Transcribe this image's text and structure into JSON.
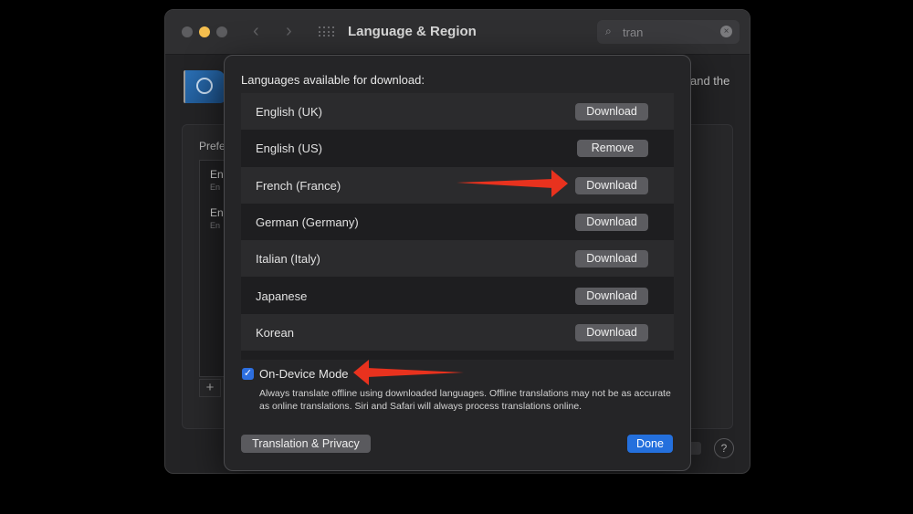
{
  "window": {
    "title": "Language & Region",
    "search_value": "tran",
    "background_right_text": "and the",
    "preferred_label": "Prefe",
    "preferred_items": [
      {
        "name": "En",
        "sub": "En"
      },
      {
        "name": "En",
        "sub": "En"
      }
    ],
    "add_symbol": "+",
    "help_symbol": "?"
  },
  "sheet": {
    "heading": "Languages available for download:",
    "languages": [
      {
        "name": "English (UK)",
        "action": "Download"
      },
      {
        "name": "English (US)",
        "action": "Remove"
      },
      {
        "name": "French (France)",
        "action": "Download"
      },
      {
        "name": "German (Germany)",
        "action": "Download"
      },
      {
        "name": "Italian (Italy)",
        "action": "Download"
      },
      {
        "name": "Japanese",
        "action": "Download"
      },
      {
        "name": "Korean",
        "action": "Download"
      }
    ],
    "on_device_mode": {
      "label": "On-Device Mode",
      "checked": true,
      "check_glyph": "✓",
      "description": "Always translate offline using downloaded languages. Offline translations may not be as accurate as online translations. Siri and Safari will always process translations online."
    },
    "translation_privacy_button": "Translation & Privacy",
    "done_button": "Done"
  },
  "colors": {
    "accent": "#2470dd",
    "annotation_arrow": "#e8321e"
  }
}
